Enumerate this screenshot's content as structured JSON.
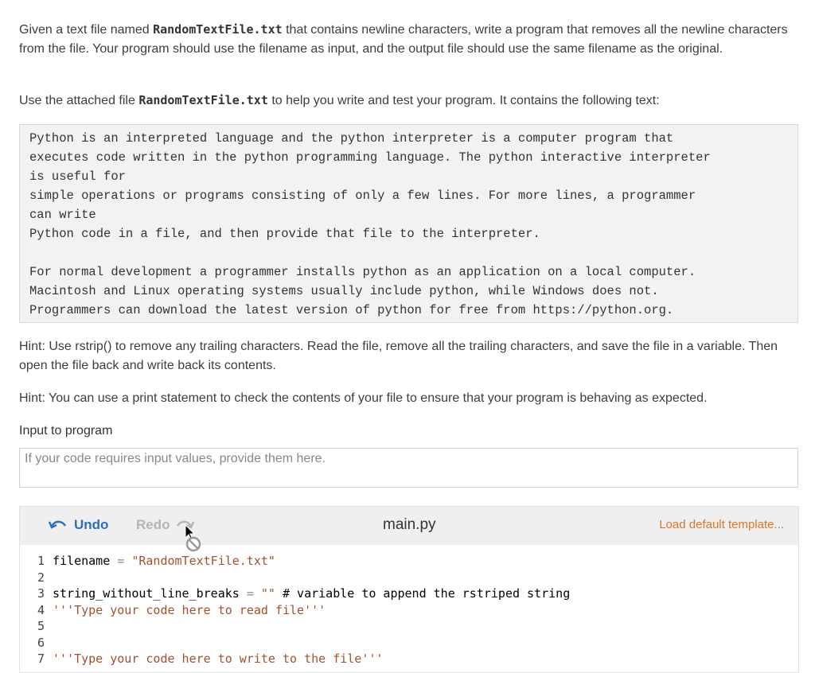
{
  "instructions": {
    "p1_a": "Given a text file named ",
    "p1_file": "RandomTextFile.txt",
    "p1_b": " that contains newline characters, write a program that removes all the newline characters from the file. Your program should use the filename as input, and the output file should use the same filename as the original.",
    "p2_a": "Use the attached file ",
    "p2_file": "RandomTextFile.txt",
    "p2_b": " to help you write and test your program. It contains the following text:",
    "sample_text": "Python is an interpreted language and the python interpreter is a computer program that\nexecutes code written in the python programming language. The python interactive interpreter\nis useful for\nsimple operations or programs consisting of only a few lines. For more lines, a programmer\ncan write\nPython code in a file, and then provide that file to the interpreter.\n\nFor normal development a programmer installs python as an application on a local computer.\nMacintosh and Linux operating systems usually include python, while Windows does not.\nProgrammers can download the latest version of python for free from https://python.org.",
    "hint1": "Hint: Use rstrip() to remove any trailing characters. Read the file, remove all the trailing characters, and save the file in a variable. Then open the file back and write back its contents.",
    "hint2": "Hint: You can use a print statement to check the contents of your file to ensure that your program is behaving as expected."
  },
  "input": {
    "label": "Input to program",
    "placeholder": "If your code requires input values, provide them here."
  },
  "editor": {
    "undo_label": "Undo",
    "redo_label": "Redo",
    "filename": "main.py",
    "load_default_label": "Load default template...",
    "lines": [
      {
        "n": "1",
        "a": "filename ",
        "op": "=",
        "b": " ",
        "s": "\"RandomTextFile.txt\"",
        "c": ""
      },
      {
        "n": "2",
        "a": "",
        "op": "",
        "b": "",
        "s": "",
        "c": ""
      },
      {
        "n": "3",
        "a": "string_without_line_breaks ",
        "op": "=",
        "b": " ",
        "s": "\"\"",
        "c": " # variable to append the rstriped string"
      },
      {
        "n": "4",
        "a": "",
        "op": "",
        "b": "",
        "s": "'''Type your code here to read file'''",
        "c": ""
      },
      {
        "n": "5",
        "a": "",
        "op": "",
        "b": "",
        "s": "",
        "c": ""
      },
      {
        "n": "6",
        "a": "",
        "op": "",
        "b": "",
        "s": "",
        "c": ""
      },
      {
        "n": "7",
        "a": "",
        "op": "",
        "b": "",
        "s": "'''Type your code here to write to the file'''",
        "c": ""
      }
    ]
  },
  "colors": {
    "accent_blue": "#2f6fb3",
    "load_orange": "#d9782d",
    "string_brown": "#a0522d"
  }
}
